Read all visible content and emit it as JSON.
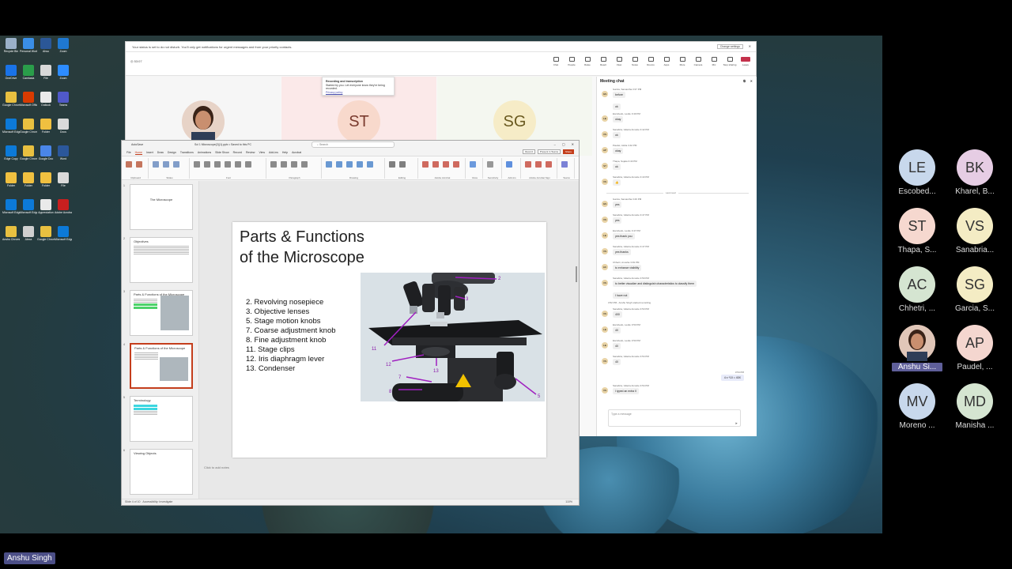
{
  "desktop_icons": [
    {
      "label": "Recycle Bin"
    },
    {
      "label": "Personal Workspace"
    },
    {
      "label": "Ahsu"
    },
    {
      "label": "Zoom"
    },
    {
      "label": "OneDrive"
    },
    {
      "label": "Camtasia"
    },
    {
      "label": "File"
    },
    {
      "label": "Zoom"
    },
    {
      "label": "Google Chrome"
    },
    {
      "label": "Microsoft Office"
    },
    {
      "label": "Outlook"
    },
    {
      "label": "Teams"
    },
    {
      "label": "Microsoft Edge"
    },
    {
      "label": "Google Chrome"
    },
    {
      "label": "Folder"
    },
    {
      "label": "Docs"
    },
    {
      "label": "Edge Copy"
    },
    {
      "label": "Google Chrome"
    },
    {
      "label": "Google Doc"
    },
    {
      "label": "Word"
    },
    {
      "label": "Folder"
    },
    {
      "label": "Folder"
    },
    {
      "label": "Folder"
    },
    {
      "label": "File"
    },
    {
      "label": "Microsoft Edge"
    },
    {
      "label": "Microsoft Edge"
    },
    {
      "label": "Appreciation"
    },
    {
      "label": "Adobe Acrobat"
    },
    {
      "label": "Anshu Chrome"
    },
    {
      "label": "Alexa"
    },
    {
      "label": "Google Chrome"
    },
    {
      "label": "Microsoft Edge"
    }
  ],
  "teams": {
    "dnd_banner": "Your status is set to do not disturb. You'll only get notifications for urgent messages and from your priority contacts.",
    "change_settings": "Change settings",
    "timer": "53:07",
    "toolbar": [
      "Chat",
      "People",
      "Raise",
      "React",
      "View",
      "Notes",
      "Rooms",
      "Apps",
      "More",
      "Camera",
      "Mic",
      "Stop sharing",
      "Leave"
    ],
    "recording_popup": {
      "title": "Recording and transcription",
      "body": "Started by you. Let everyone know they're being recorded.",
      "link": "Privacy policy"
    },
    "stage_tiles": [
      {
        "initials": "",
        "photo": true,
        "color": "#fbe4e4"
      },
      {
        "initials": "ST",
        "photo": false,
        "color": "#f8d9cc"
      },
      {
        "initials": "SG",
        "photo": false,
        "color": "#f6ecc7"
      }
    ],
    "chat": {
      "title": "Meeting chat",
      "messages": [
        {
          "sender": "Garcia, Samantha",
          "time": "3:37 PM",
          "text": "before",
          "initials": "GS"
        },
        {
          "sender": "",
          "time": "",
          "text": "ok",
          "initials": ""
        },
        {
          "sender": "Escobedo, Leslie",
          "time": "3:40 PM",
          "text": "okay",
          "initials": "LE"
        },
        {
          "sender": "Sanabria, Valeria Annette",
          "time": "3:42 PM",
          "text": "ok",
          "initials": "VS"
        },
        {
          "sender": "Paudel, Aisha",
          "time": "3:42 PM",
          "text": "okay",
          "initials": "AP"
        },
        {
          "sender": "Thapa, Sujata",
          "time": "3:43 PM",
          "text": "ok",
          "initials": "ST"
        },
        {
          "sender": "Sanabria, Valeria Annette",
          "time": "3:43 PM",
          "text": "👍",
          "initials": "VS"
        }
      ],
      "divider": "Last read",
      "messages2": [
        {
          "sender": "Garcia, Samantha",
          "time": "3:46 PM",
          "text": "yes",
          "initials": "GS"
        },
        {
          "sender": "Sanabria, Valeria Annette",
          "time": "3:47 PM",
          "text": "yes",
          "initials": "VS"
        },
        {
          "sender": "Escobedo, Leslie",
          "time": "3:47 PM",
          "text": "yes thank you",
          "initials": "LE"
        },
        {
          "sender": "Sanabria, Valeria Annette",
          "time": "3:47 PM",
          "text": "yes thanks",
          "initials": "VS"
        },
        {
          "sender": "Chhetri, Anusha",
          "time": "3:49 PM",
          "text": "to enhance visibility",
          "initials": "AC"
        },
        {
          "sender": "Sanabria, Valeria Annette",
          "time": "3:50 PM",
          "text": "to better visualize and distinguish characteristics to classify them",
          "initials": "VS"
        },
        {
          "sender": "",
          "time": "",
          "text": "I have not",
          "initials": ""
        }
      ],
      "system": "3:52 PM - Anshu Singh started recording",
      "messages3": [
        {
          "sender": "Sanabria, Valeria Annette",
          "time": "3:53 PM",
          "text": "400",
          "initials": "VS"
        },
        {
          "sender": "Escobedo, Leslie",
          "time": "3:53 PM",
          "text": "40",
          "initials": "LE"
        },
        {
          "sender": "Escobedo, Leslie",
          "time": "3:53 PM",
          "text": "40",
          "initials": "LE"
        },
        {
          "sender": "Sanabria, Valeria Annette",
          "time": "3:54 PM",
          "text": "40",
          "initials": "VS"
        }
      ],
      "mine_time": "3:54 PM",
      "mine_text": "4 x *10 = 40X",
      "last_msg": {
        "sender": "Sanabria, Valeria Annette",
        "time": "3:54 PM",
        "text": "I typed an extra 0",
        "initials": "VS"
      },
      "compose_placeholder": "Type a message"
    }
  },
  "ppt": {
    "autosave": "AutoSave",
    "filename": "Sci 1 Microscope(2)(1).pptx • Saved to this PC",
    "search": "Search",
    "tabs": [
      "File",
      "Home",
      "Insert",
      "Draw",
      "Design",
      "Transitions",
      "Animations",
      "Slide Show",
      "Record",
      "Review",
      "View",
      "Add-ins",
      "Help",
      "Acrobat"
    ],
    "active_tab": "Home",
    "right_buttons": [
      "Record",
      "Present in Teams",
      "Share"
    ],
    "ribbon_groups": [
      "Clipboard",
      "Slides",
      "Font",
      "Paragraph",
      "Drawing",
      "Editing",
      "Adobe Acrobat",
      "Voice",
      "Sensitivity",
      "Add-ins",
      "Adobe Acrobat Sign",
      "Teams"
    ],
    "slide_title_line1": "Parts & Functions",
    "slide_title_line2": "of the Microscope",
    "slide_items": [
      "2.  Revolving nosepiece",
      "3.  Objective lenses",
      "5.  Stage motion knobs",
      "7.   Coarse adjustment knob",
      "8.   Fine adjustment knob",
      "11. Stage clips",
      "12. Iris diaphragm lever",
      "13. Condenser"
    ],
    "image_labels": [
      "2",
      "3",
      "11",
      "12",
      "13",
      "7",
      "8",
      "5"
    ],
    "thumbnails": [
      {
        "num": "1",
        "title": "The Microscope",
        "sub": ""
      },
      {
        "num": "2",
        "title": "Objectives",
        "sub": ""
      },
      {
        "num": "3",
        "title": "Parts & Functions of the Microscope",
        "sub": ""
      },
      {
        "num": "4",
        "title": "Parts & Functions of the Microscope",
        "sub": ""
      },
      {
        "num": "5",
        "title": "Terminology",
        "sub": ""
      },
      {
        "num": "6",
        "title": "Viewing Objects",
        "sub": ""
      }
    ],
    "notes_placeholder": "Click to add notes",
    "status_left": "Slide 4 of 10",
    "status_access": "Accessibility: Investigate",
    "zoom": "110%"
  },
  "participants": [
    {
      "initials": "LE",
      "name": "Escobed...",
      "color": "#c8d8ec",
      "photo": false
    },
    {
      "initials": "BK",
      "name": "Kharel, B...",
      "color": "#e6cde4",
      "photo": false
    },
    {
      "initials": "ST",
      "name": "Thapa, S...",
      "color": "#f6d8cf",
      "photo": false
    },
    {
      "initials": "VS",
      "name": "Sanabria...",
      "color": "#f4ecc4",
      "photo": false
    },
    {
      "initials": "AC",
      "name": "Chhetri, ...",
      "color": "#d5e5d1",
      "photo": false
    },
    {
      "initials": "SG",
      "name": "Garcia, S...",
      "color": "#f4ecc4",
      "photo": false
    },
    {
      "initials": "",
      "name": "Anshu Si...",
      "color": "#e4b6a6",
      "photo": true
    },
    {
      "initials": "AP",
      "name": "Paudel, ...",
      "color": "#f4d6cf",
      "photo": false
    },
    {
      "initials": "MV",
      "name": "Moreno ...",
      "color": "#c8d8ec",
      "photo": false
    },
    {
      "initials": "MD",
      "name": "Manisha ...",
      "color": "#d5e5d1",
      "photo": false
    }
  ],
  "self_label": "Anshu Singh"
}
